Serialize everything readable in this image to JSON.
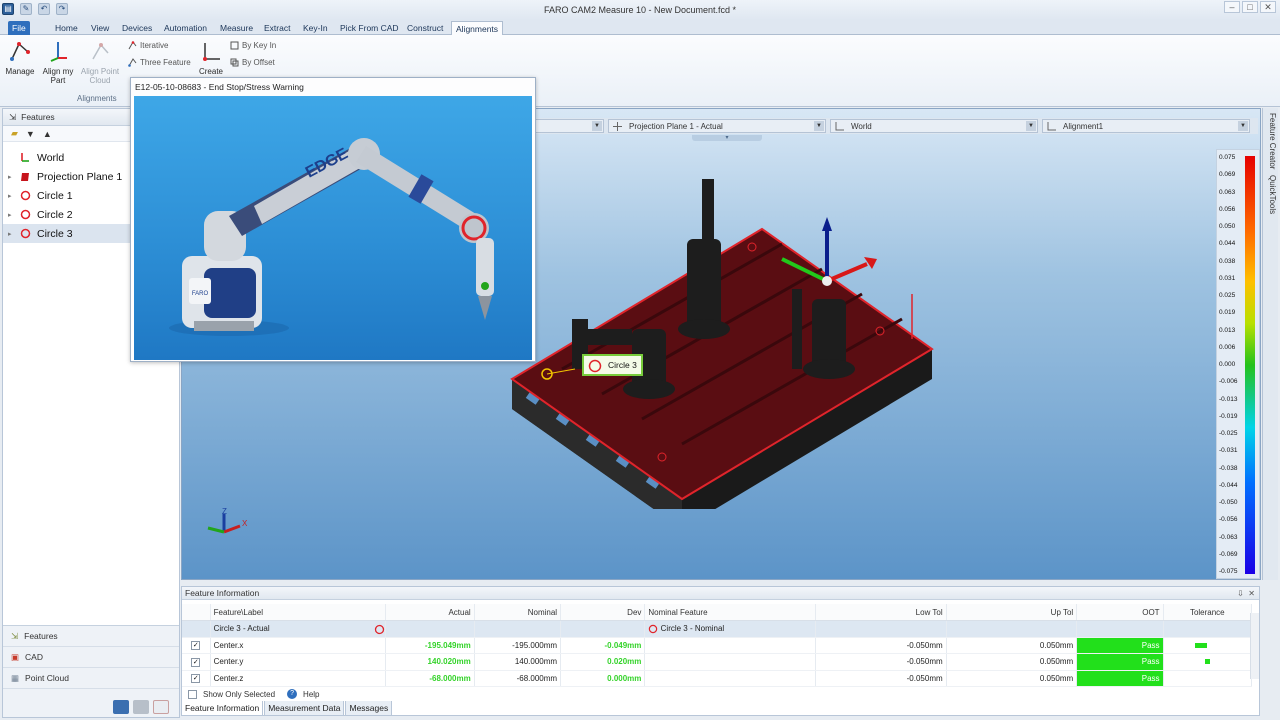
{
  "window": {
    "title": "FARO CAM2 Measure 10 - New Document.fcd *"
  },
  "ribbon_tabs": [
    {
      "label": "File"
    },
    {
      "label": "Home"
    },
    {
      "label": "View"
    },
    {
      "label": "Devices"
    },
    {
      "label": "Automation"
    },
    {
      "label": "Measure"
    },
    {
      "label": "Extract"
    },
    {
      "label": "Key-In"
    },
    {
      "label": "Pick From CAD"
    },
    {
      "label": "Construct"
    },
    {
      "label": "Alignments"
    }
  ],
  "ribbon": {
    "manage": "Manage",
    "align_my_part_line1": "Align my",
    "align_my_part_line2": "Part",
    "align_point_cloud_line1": "Align Point",
    "align_point_cloud_line2": "Cloud",
    "iterative": "Iterative",
    "three_feature": "Three Feature",
    "create": "Create",
    "by_key_in": "By Key In",
    "by_offset": "By Offset",
    "group_label": "Alignments"
  },
  "left_panel": {
    "header": "Features",
    "tree": [
      {
        "label": "World"
      },
      {
        "label": "Projection Plane 1"
      },
      {
        "label": "Circle 1"
      },
      {
        "label": "Circle 2"
      },
      {
        "label": "Circle 3"
      }
    ],
    "nav": [
      {
        "label": "Features"
      },
      {
        "label": "CAD"
      },
      {
        "label": "Point Cloud"
      }
    ]
  },
  "viewport": {
    "combo_plane": "Projection Plane 1 - Actual",
    "combo_world": "World",
    "combo_alignment": "Alignment1",
    "feature_callout": "Circle 3",
    "axis_z": "Z",
    "axis_x": "X",
    "scale_labels": [
      "0.075",
      "0.069",
      "0.063",
      "0.056",
      "0.050",
      "0.044",
      "0.038",
      "0.031",
      "0.025",
      "0.019",
      "0.013",
      "0.006",
      "0.000",
      "-0.006",
      "-0.013",
      "-0.019",
      "-0.025",
      "-0.031",
      "-0.038",
      "-0.044",
      "-0.050",
      "-0.056",
      "-0.063",
      "-0.069",
      "-0.075"
    ]
  },
  "side_tabs": {
    "feature_creator": "Feature Creator",
    "quicktools": "QuickTools"
  },
  "popup": {
    "title": "E12-05-10-08683 - End Stop/Stress Warning",
    "arm_label": "EDGE",
    "base_badge": "FARO"
  },
  "feature_info": {
    "header": "Feature Information",
    "columns": {
      "label": "Feature\\Label",
      "actual": "Actual",
      "nominal": "Nominal",
      "dev": "Dev",
      "nominal_feature": "Nominal Feature",
      "low_tol": "Low Tol",
      "up_tol": "Up Tol",
      "oot": "OOT",
      "tolerance": "Tolerance"
    },
    "group_row": {
      "label": "Circle 3 - Actual",
      "nominal_feature": "Circle 3 - Nominal"
    },
    "rows": [
      {
        "label": "Center.x",
        "actual": "-195.049mm",
        "nominal": "-195.000mm",
        "dev": "-0.049mm",
        "low_tol": "-0.050mm",
        "up_tol": "0.050mm",
        "oot": "Pass"
      },
      {
        "label": "Center.y",
        "actual": "140.020mm",
        "nominal": "140.000mm",
        "dev": "0.020mm",
        "low_tol": "-0.050mm",
        "up_tol": "0.050mm",
        "oot": "Pass"
      },
      {
        "label": "Center.z",
        "actual": "-68.000mm",
        "nominal": "-68.000mm",
        "dev": "0.000mm",
        "low_tol": "-0.050mm",
        "up_tol": "0.050mm",
        "oot": "Pass"
      }
    ],
    "show_only_selected": "Show Only Selected",
    "help": "Help"
  },
  "bottom_tabs": [
    {
      "label": "Feature Information"
    },
    {
      "label": "Measurement Data"
    },
    {
      "label": "Messages"
    }
  ],
  "colors": {
    "accent": "#2f6fbd",
    "pass": "#22e01b",
    "feature_red": "#e0242b",
    "viewport_top": "#d8e7f5",
    "viewport_bottom": "#5c94c8"
  }
}
